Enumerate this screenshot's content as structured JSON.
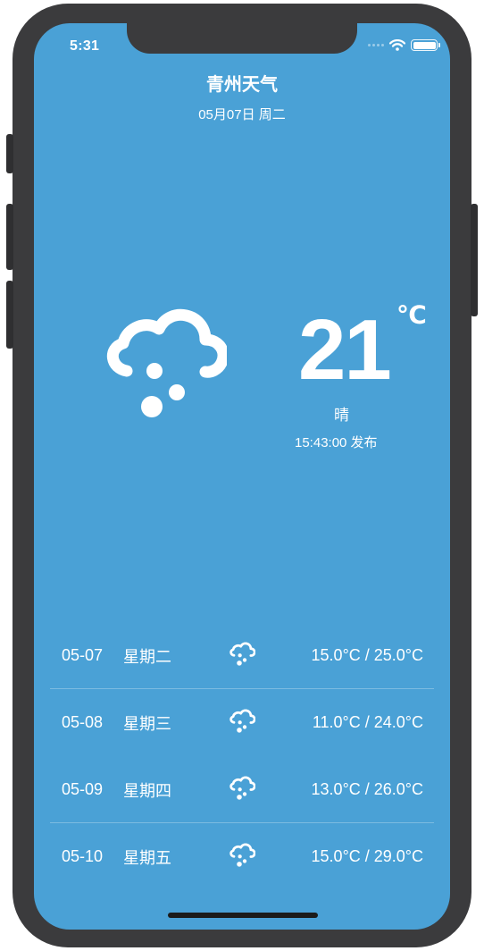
{
  "status": {
    "time": "5:31",
    "icons": [
      "signal-dots-icon",
      "wifi-icon",
      "battery-icon"
    ],
    "battery_level": 1.0
  },
  "header": {
    "city_title": "青州天气",
    "date": "05月07日 周二"
  },
  "current": {
    "icon": "cloud-hail-icon",
    "temperature": "21",
    "unit": "℃",
    "condition": "晴",
    "published": "15:43:00 发布"
  },
  "forecast": [
    {
      "date": "05-07",
      "weekday": "星期二",
      "icon": "cloud-hail-icon",
      "range": "15.0°C / 25.0°C"
    },
    {
      "date": "05-08",
      "weekday": "星期三",
      "icon": "cloud-hail-icon",
      "range": "11.0°C / 24.0°C"
    },
    {
      "date": "05-09",
      "weekday": "星期四",
      "icon": "cloud-hail-icon",
      "range": "13.0°C / 26.0°C"
    },
    {
      "date": "05-10",
      "weekday": "星期五",
      "icon": "cloud-hail-icon",
      "range": "15.0°C / 29.0°C"
    }
  ],
  "colors": {
    "background": "#4aa1d6",
    "text": "#ffffff",
    "device_frame": "#3b3b3d"
  }
}
